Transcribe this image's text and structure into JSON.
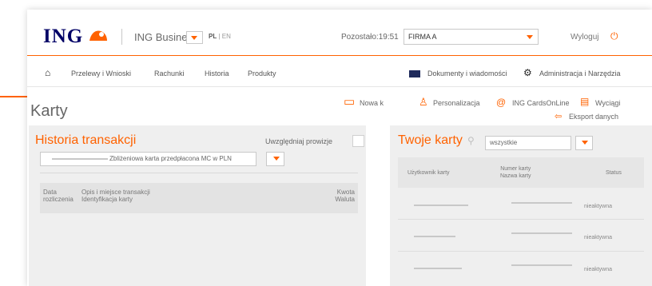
{
  "header": {
    "logo": "ING",
    "product_name": "ING Business",
    "lang_active": "PL",
    "lang_sep": " | ",
    "lang_other": "EN",
    "session_label": "Pozostało:",
    "session_time": "19:51",
    "company": "FIRMA A",
    "logout_label": "Wyloguj"
  },
  "nav": {
    "items": [
      "Przelewy i Wnioski",
      "Rachunki",
      "Historia",
      "Produkty"
    ],
    "documents_label": "Dokumenty i wiadomości",
    "admin_label": "Administracja i Narzędzia"
  },
  "page": {
    "title": "Karty",
    "actions": {
      "new_card": "Nowa k",
      "personalization": "Personalizacja",
      "cards_online": "ING CardsOnLine",
      "statements": "Wyciągi",
      "export": "Eksport danych"
    }
  },
  "history": {
    "title": "Historia transakcji",
    "include_fees_label": "Uwzględniaj prowizje",
    "card_select_value": "Zbliżeniowa karta przedpłacona MC w PLN",
    "columns": {
      "date_line1": "Data",
      "date_line2": "rozliczenia",
      "desc_line1": "Opis i miejsce transakcji",
      "desc_line2": "Identyfikacja karty",
      "amount_line1": "Kwota",
      "amount_line2": "Waluta"
    }
  },
  "cards": {
    "title": "Twoje karty",
    "filter_value": "wszystkie",
    "columns": {
      "user": "Użytkownik karty",
      "number_line1": "Numer karty",
      "number_line2": "Nazwa karty",
      "status": "Status"
    },
    "rows": [
      {
        "status": "nieaktywna"
      },
      {
        "status": "nieaktywna"
      },
      {
        "status": "nieaktywna"
      }
    ]
  },
  "colors": {
    "accent": "#ff6200",
    "brand_navy": "#000066"
  }
}
